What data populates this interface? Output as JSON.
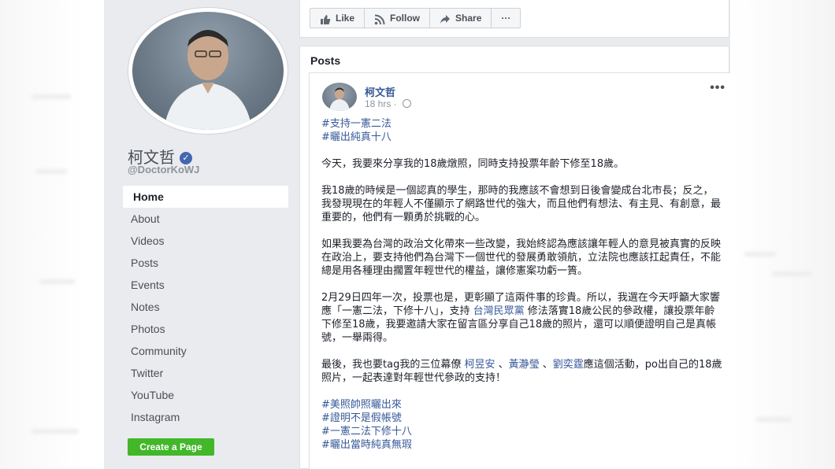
{
  "page": {
    "name": "柯文哲",
    "handle": "@DoctorKoWJ"
  },
  "nav": [
    "Home",
    "About",
    "Videos",
    "Posts",
    "Events",
    "Notes",
    "Photos",
    "Community",
    "Twitter",
    "YouTube",
    "Instagram"
  ],
  "create_page_label": "Create a Page",
  "actions": {
    "like": "Like",
    "follow": "Follow",
    "share": "Share",
    "more": "···"
  },
  "posts_title": "Posts",
  "post": {
    "author": "柯文哲",
    "time": "18 hrs · ",
    "more": "•••",
    "hashtags_top": [
      "#支持一憲二法",
      "#曬出純真十八"
    ],
    "p1": "今天，我要來分享我的18歲燉照，同時支持投票年齡下修至18歲。",
    "p2": "我18歲的時候是一個認真的學生，那時的我應該不會想到日後會變成台北市長；反之，我發現現在的年輕人不僅顯示了網路世代的強大，而且他們有想法、有主見、有創意，最重要的，他們有一顆勇於挑戰的心。",
    "p3": "如果我要為台灣的政治文化帶來一些改變，我始終認為應該讓年輕人的意見被真實的反映在政治上，要支持他們為台灣下一個世代的發展勇敢領航，立法院也應該扛起責任，不能總是用各種理由擱置年輕世代的權益，讓修憲案功虧一簣。",
    "p4a": "2月29日四年一次，投票也是，更彰顯了這兩件事的珍貴。所以，我選在今天呼籲大家響應「一憲二法，下修十八」，支持 ",
    "p4_mention": "台灣民眾黨",
    "p4b": " 修法落實18歲公民的參政權，讓投票年齡下修至18歲，我要邀請大家在留言區分享自己18歲的照片，還可以順便證明自己是真帳號，一舉兩得。",
    "p5a": "最後，我也要tag我的三位幕僚 ",
    "p5_m1": "柯昱安",
    "p5_sep1": " 、",
    "p5_m2": "黃瀞瑩",
    "p5_sep2": " 、",
    "p5_m3": "劉奕霆",
    "p5b": "應這個活動，po出自己的18歲照片，一起表達對年輕世代參政的支持！",
    "hashtags_bottom": [
      "#美照帥照曬出來",
      "#證明不是假帳號",
      "#一憲二法下修十八",
      "#曬出當時純真無瑕"
    ]
  },
  "colors": {
    "link": "#365899",
    "green": "#42b72a",
    "verified": "#4267b2",
    "background": "#e9ebee"
  }
}
